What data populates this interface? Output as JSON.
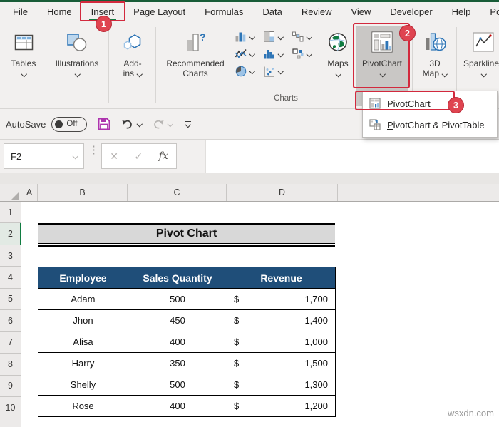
{
  "window": {
    "watermark": "wsxdn.com"
  },
  "tabs": {
    "items": [
      {
        "label": "File"
      },
      {
        "label": "Home"
      },
      {
        "label": "Insert"
      },
      {
        "label": "Page Layout"
      },
      {
        "label": "Formulas"
      },
      {
        "label": "Data"
      },
      {
        "label": "Review"
      },
      {
        "label": "View"
      },
      {
        "label": "Developer"
      },
      {
        "label": "Help"
      },
      {
        "label": "Power Pivot"
      }
    ]
  },
  "ribbon": {
    "tables_label": "Tables",
    "illustrations_label": "Illustrations",
    "addins_line1": "Add-",
    "addins_line2": "ins",
    "recommended_line1": "Recommended",
    "recommended_line2": "Charts",
    "maps_label": "Maps",
    "pivotchart_label": "PivotChart",
    "threed_line1": "3D",
    "threed_line2": "Map",
    "sparklines_label": "Sparklines",
    "charts_group_label": "Charts"
  },
  "qat": {
    "autosave_label": "AutoSave",
    "autosave_state": "Off"
  },
  "formula_bar": {
    "name_box_value": "F2",
    "cancel_glyph": "✕",
    "enter_glyph": "✓",
    "fx_label": "fx"
  },
  "annotations": {
    "step1": "1",
    "step2": "2",
    "step3": "3"
  },
  "menu": {
    "items": [
      {
        "pre": "Pivot",
        "key": "C",
        "post": "hart"
      },
      {
        "pre": "",
        "key": "P",
        "post": "ivotChart & PivotTable"
      }
    ]
  },
  "sheet": {
    "column_headers": [
      "A",
      "B",
      "C",
      "D"
    ],
    "row_numbers": [
      "1",
      "2",
      "3",
      "4",
      "5",
      "6",
      "7",
      "8",
      "9",
      "10"
    ],
    "title": "Pivot Chart",
    "table": {
      "headers": [
        "Employee",
        "Sales Quantity",
        "Revenue"
      ],
      "rows": [
        {
          "employee": "Adam",
          "quantity": "500",
          "currency": "$",
          "revenue": "1,700"
        },
        {
          "employee": "Jhon",
          "quantity": "450",
          "currency": "$",
          "revenue": "1,400"
        },
        {
          "employee": "Alisa",
          "quantity": "400",
          "currency": "$",
          "revenue": "1,000"
        },
        {
          "employee": "Harry",
          "quantity": "350",
          "currency": "$",
          "revenue": "1,500"
        },
        {
          "employee": "Shelly",
          "quantity": "500",
          "currency": "$",
          "revenue": "1,300"
        },
        {
          "employee": "Rose",
          "quantity": "400",
          "currency": "$",
          "revenue": "1,200"
        }
      ]
    }
  }
}
